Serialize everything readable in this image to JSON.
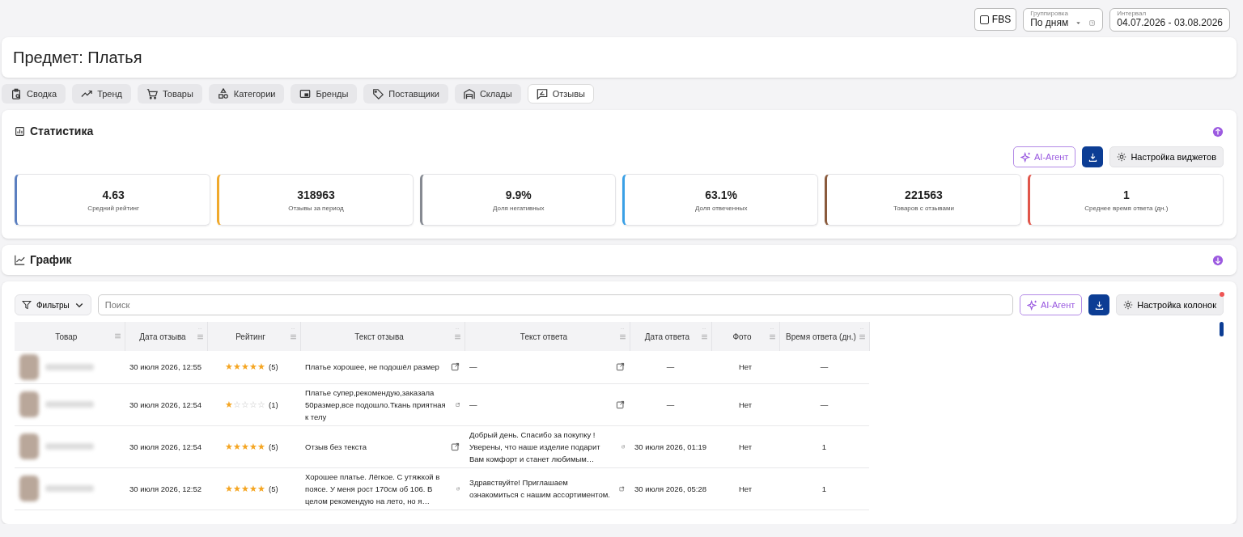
{
  "top_controls": {
    "fbs": {
      "label": "FBS",
      "checked": false
    },
    "grouping": {
      "legend": "Группировка",
      "value": "По дням"
    },
    "interval": {
      "legend": "Интервал",
      "value": "04.07.2026 - 03.08.2026"
    }
  },
  "title": "Предмет: Платья",
  "tabs": [
    {
      "label": "Сводка",
      "selected": false
    },
    {
      "label": "Тренд",
      "selected": false
    },
    {
      "label": "Товары",
      "selected": false
    },
    {
      "label": "Категории",
      "selected": false
    },
    {
      "label": "Бренды",
      "selected": false
    },
    {
      "label": "Поставщики",
      "selected": false
    },
    {
      "label": "Склады",
      "selected": false
    },
    {
      "label": "Отзывы",
      "selected": true
    }
  ],
  "statistics": {
    "title": "Статистика",
    "expanded": true,
    "ai_button": "AI-Агент",
    "settings_button": "Настройка виджетов",
    "metrics": [
      {
        "value": "4.63",
        "label": "Средний рейтинг",
        "color": "#5b7fc0"
      },
      {
        "value": "318963",
        "label": "Отзывы за период",
        "color": "#f0a92c"
      },
      {
        "value": "9.9%",
        "label": "Доля негативных",
        "color": "#868a92"
      },
      {
        "value": "63.1%",
        "label": "Доля отвеченных",
        "color": "#3aa0e6"
      },
      {
        "value": "221563",
        "label": "Товаров с отзывами",
        "color": "#8a5a3c"
      },
      {
        "value": "1",
        "label": "Среднее время ответа (дн.)",
        "color": "#e0554a"
      }
    ]
  },
  "graph": {
    "title": "График",
    "expanded": false
  },
  "reviews": {
    "filters_button": "Фильтры",
    "search_placeholder": "Поиск",
    "ai_button": "AI-Агент",
    "columns_button": "Настройка колонок",
    "columns": [
      "Товар",
      "Дата отзыва",
      "Рейтинг",
      "Текст отзыва",
      "Текст ответа",
      "Дата ответа",
      "Фото",
      "Время ответа (дн.)"
    ],
    "rows": [
      {
        "date": "30 июля 2026, 12:55",
        "stars": 5,
        "rating": "(5)",
        "review": "Платье хорошее, не подошёл размер",
        "answer": "—",
        "answer_date": "—",
        "photo": "Нет",
        "response_time": "—"
      },
      {
        "date": "30 июля 2026, 12:54",
        "stars": 1,
        "rating": "(1)",
        "review": "Платье супер,рекомендую,заказала 50размер,все подошло.Ткань приятная к телу",
        "answer": "—",
        "answer_date": "—",
        "photo": "Нет",
        "response_time": "—"
      },
      {
        "date": "30 июля 2026, 12:54",
        "stars": 5,
        "rating": "(5)",
        "review": "Отзыв без текста",
        "answer": "Добрый день. Спасибо за покупку ! Уверены, что наше изделие подарит Вам комфорт и станет любимым…",
        "answer_date": "30 июля 2026, 01:19",
        "photo": "Нет",
        "response_time": "1"
      },
      {
        "date": "30 июля 2026, 12:52",
        "stars": 5,
        "rating": "(5)",
        "review": "Хорошее платье. Лёгкое. С утяжкой в поясе. У меня рост 170см об 106. В целом рекомендую на лето, но я…",
        "answer": "Здравствуйте! Приглашаем ознакомиться с нашим ассортиментом.",
        "answer_date": "30 июля 2026, 05:28",
        "photo": "Нет",
        "response_time": "1"
      }
    ]
  }
}
